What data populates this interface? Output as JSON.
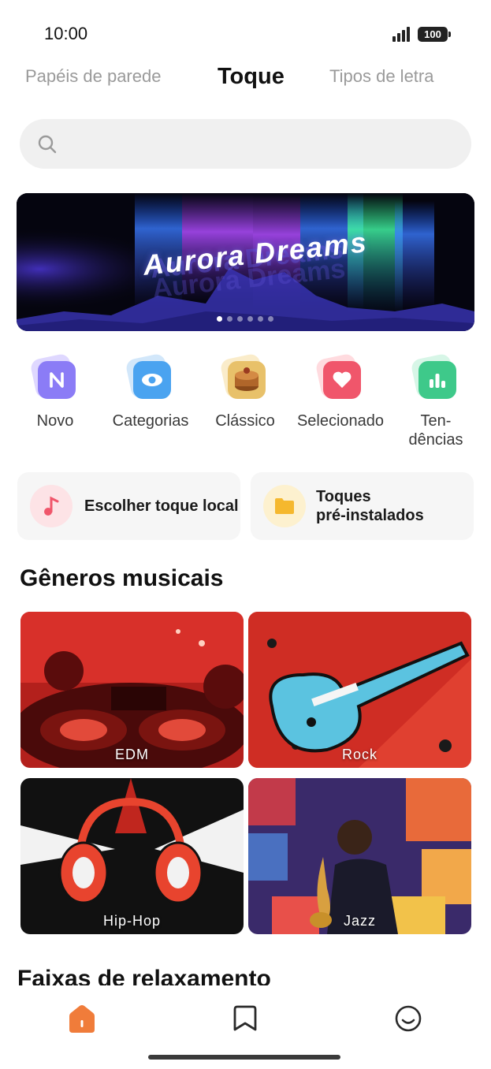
{
  "status": {
    "time": "10:00",
    "battery": "100"
  },
  "tabs": [
    {
      "label": "Papéis de parede",
      "active": false
    },
    {
      "label": "Toque",
      "active": true
    },
    {
      "label": "Tipos de letra",
      "active": false
    }
  ],
  "search": {
    "placeholder": ""
  },
  "banner": {
    "title": "Aurora Dreams",
    "page_count": 6,
    "active_page": 1
  },
  "quick_items": [
    {
      "label": "Novo",
      "icon": "new-n-icon",
      "color": "#8b7cf6"
    },
    {
      "label": "Categorias",
      "icon": "eye-icon",
      "color": "#4aa3f0"
    },
    {
      "label": "Clássico",
      "icon": "music-box-icon",
      "color": "#c77d2e"
    },
    {
      "label": "Selecionado",
      "icon": "heart-icon",
      "color": "#f0566b"
    },
    {
      "label": "Ten-\ndências",
      "icon": "bar-chart-icon",
      "color": "#3ec98a"
    }
  ],
  "cards": {
    "local": {
      "label": "Escolher toque local",
      "icon": "music-note-icon"
    },
    "preinstalled": {
      "label": "Toques\npré-instalados",
      "icon": "folder-icon"
    }
  },
  "sections": {
    "genres_title": "Gêneros musicais",
    "relax_title": "Faixas de relaxamento"
  },
  "genres": [
    {
      "label": "EDM"
    },
    {
      "label": "Rock"
    },
    {
      "label": "Hip-Hop"
    },
    {
      "label": "Jazz"
    }
  ],
  "colors": {
    "accent": "#f07c3a",
    "search_bg": "#f0f0f0",
    "card_bg": "#f6f6f6"
  },
  "nav": [
    {
      "name": "home-icon",
      "active": true
    },
    {
      "name": "bookmark-icon",
      "active": false
    },
    {
      "name": "smiley-icon",
      "active": false
    }
  ]
}
